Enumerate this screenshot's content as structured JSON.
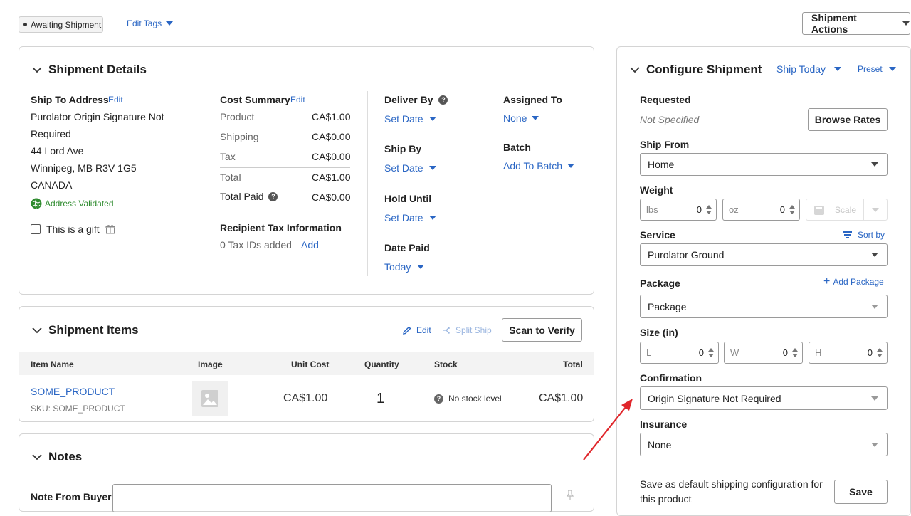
{
  "topbar": {
    "status_badge": "Awaiting Shipment",
    "edit_tags": "Edit Tags",
    "shipment_actions": "Shipment Actions"
  },
  "details": {
    "title": "Shipment Details",
    "ship_to_label": "Ship To Address",
    "ship_to_edit": "Edit",
    "address_lines": [
      "Purolator Origin Signature Not",
      "Required",
      "44 Lord Ave",
      "Winnipeg, MB R3V 1G5",
      "CANADA"
    ],
    "address_validated": "Address Validated",
    "gift_label": "This is a gift",
    "cost_summary_label": "Cost Summary",
    "cost_summary_edit": "Edit",
    "cost_rows": [
      {
        "label": "Product",
        "value": "CA$1.00"
      },
      {
        "label": "Shipping",
        "value": "CA$0.00"
      },
      {
        "label": "Tax",
        "value": "CA$0.00"
      },
      {
        "label": "Total",
        "value": "CA$1.00"
      }
    ],
    "total_paid_label": "Total Paid",
    "total_paid_value": "CA$0.00",
    "tax_info_label": "Recipient Tax Information",
    "tax_ids_text": "0 Tax IDs added",
    "tax_add": "Add",
    "deliver_by_label": "Deliver By",
    "deliver_by_value": "Set Date",
    "ship_by_label": "Ship By",
    "ship_by_value": "Set Date",
    "hold_until_label": "Hold Until",
    "hold_until_value": "Set Date",
    "date_paid_label": "Date Paid",
    "date_paid_value": "Today",
    "assigned_to_label": "Assigned To",
    "assigned_to_value": "None",
    "batch_label": "Batch",
    "batch_value": "Add To Batch"
  },
  "items": {
    "title": "Shipment Items",
    "edit": "Edit",
    "split_ship": "Split Ship",
    "scan_to_verify": "Scan to Verify",
    "columns": [
      "Item Name",
      "Image",
      "Unit Cost",
      "Quantity",
      "Stock",
      "Total"
    ],
    "rows": [
      {
        "name": "SOME_PRODUCT",
        "sku": "SKU: SOME_PRODUCT",
        "unit_cost": "CA$1.00",
        "quantity": "1",
        "stock": "No stock level",
        "total": "CA$1.00"
      }
    ]
  },
  "notes": {
    "title": "Notes",
    "note_from_buyer": "Note From Buyer"
  },
  "configure": {
    "title": "Configure Shipment",
    "ship_today": "Ship Today",
    "preset": "Preset",
    "requested_label": "Requested",
    "requested_value": "Not Specified",
    "browse_rates": "Browse Rates",
    "ship_from_label": "Ship From",
    "ship_from_value": "Home",
    "weight_label": "Weight",
    "weight_lbs_unit": "lbs",
    "weight_lbs_value": "0",
    "weight_oz_unit": "oz",
    "weight_oz_value": "0",
    "scale": "Scale",
    "service_label": "Service",
    "sort_by": "Sort by",
    "service_value": "Purolator Ground",
    "package_label": "Package",
    "add_package": "Add Package",
    "package_value": "Package",
    "size_label": "Size (in)",
    "size_l_unit": "L",
    "size_l_value": "0",
    "size_w_unit": "W",
    "size_w_value": "0",
    "size_h_unit": "H",
    "size_h_value": "0",
    "confirmation_label": "Confirmation",
    "confirmation_value": "Origin Signature Not Required",
    "insurance_label": "Insurance",
    "insurance_value": "None",
    "save_default_text": "Save as default shipping configuration for this product",
    "save": "Save"
  },
  "colors": {
    "link": "#2a66c4",
    "validated": "#2e8b2e",
    "annotation_arrow": "#e0262b"
  }
}
